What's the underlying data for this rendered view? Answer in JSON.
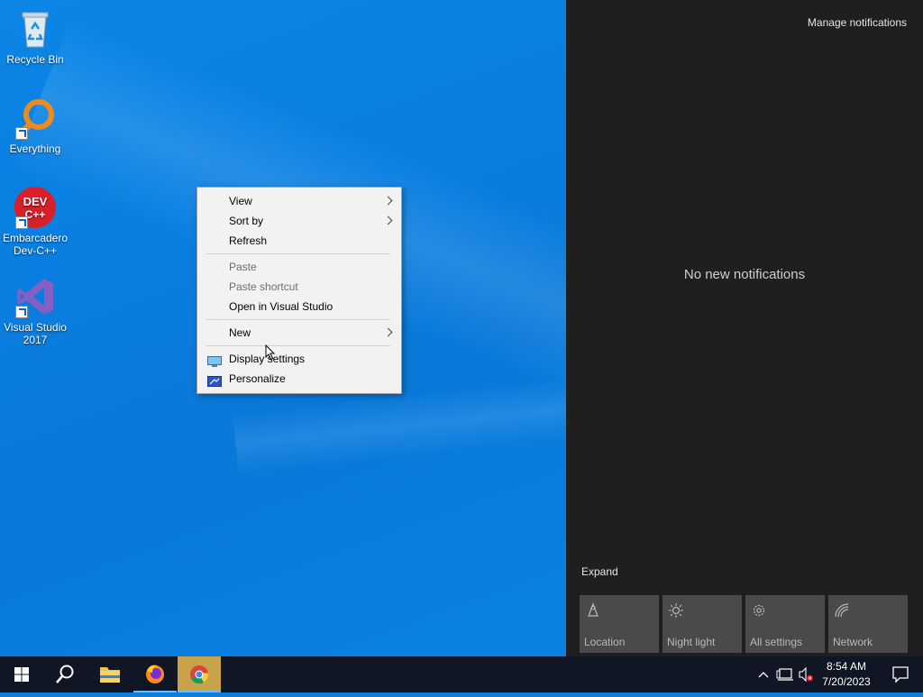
{
  "desktop": {
    "icons": [
      {
        "label_line1": "Recycle Bin",
        "label_line2": ""
      },
      {
        "label_line1": "Everything",
        "label_line2": ""
      },
      {
        "label_line1": "Embarcadero",
        "label_line2": "Dev-C++",
        "badge_text": "DEV\nC++"
      },
      {
        "label_line1": "Visual Studio",
        "label_line2": "2017"
      }
    ]
  },
  "context_menu": {
    "items": [
      {
        "label": "View",
        "submenu": true
      },
      {
        "label": "Sort by",
        "submenu": true
      },
      {
        "label": "Refresh"
      },
      {
        "label": "Paste",
        "disabled": true
      },
      {
        "label": "Paste shortcut",
        "disabled": true
      },
      {
        "label": "Open in Visual Studio"
      },
      {
        "label": "New",
        "submenu": true
      },
      {
        "label": "Display settings",
        "icon": "display-icon"
      },
      {
        "label": "Personalize",
        "icon": "personalize-icon"
      }
    ]
  },
  "notifications": {
    "manage_label": "Manage notifications",
    "empty_text": "No new notifications",
    "expand_label": "Expand",
    "quick_actions": [
      {
        "label": "Location",
        "icon": "location-icon"
      },
      {
        "label": "Night light",
        "icon": "night-light-icon"
      },
      {
        "label": "All settings",
        "icon": "gear-icon"
      },
      {
        "label": "Network",
        "icon": "network-icon"
      }
    ]
  },
  "taskbar": {
    "pinned": [
      {
        "name": "start",
        "icon": "windows-logo-icon"
      },
      {
        "name": "search",
        "icon": "search-icon"
      },
      {
        "name": "file-explorer",
        "icon": "folder-icon"
      },
      {
        "name": "firefox",
        "icon": "firefox-icon",
        "active": true
      },
      {
        "name": "chrome",
        "icon": "chrome-icon",
        "focused": true
      }
    ],
    "clock": {
      "time": "8:54 AM",
      "date": "7/20/2023"
    }
  },
  "colors": {
    "accent": "#76b9ed",
    "panel_bg": "#1f1f1f",
    "taskbar_bg": "#101623",
    "focused_task": "#c8a34a"
  }
}
